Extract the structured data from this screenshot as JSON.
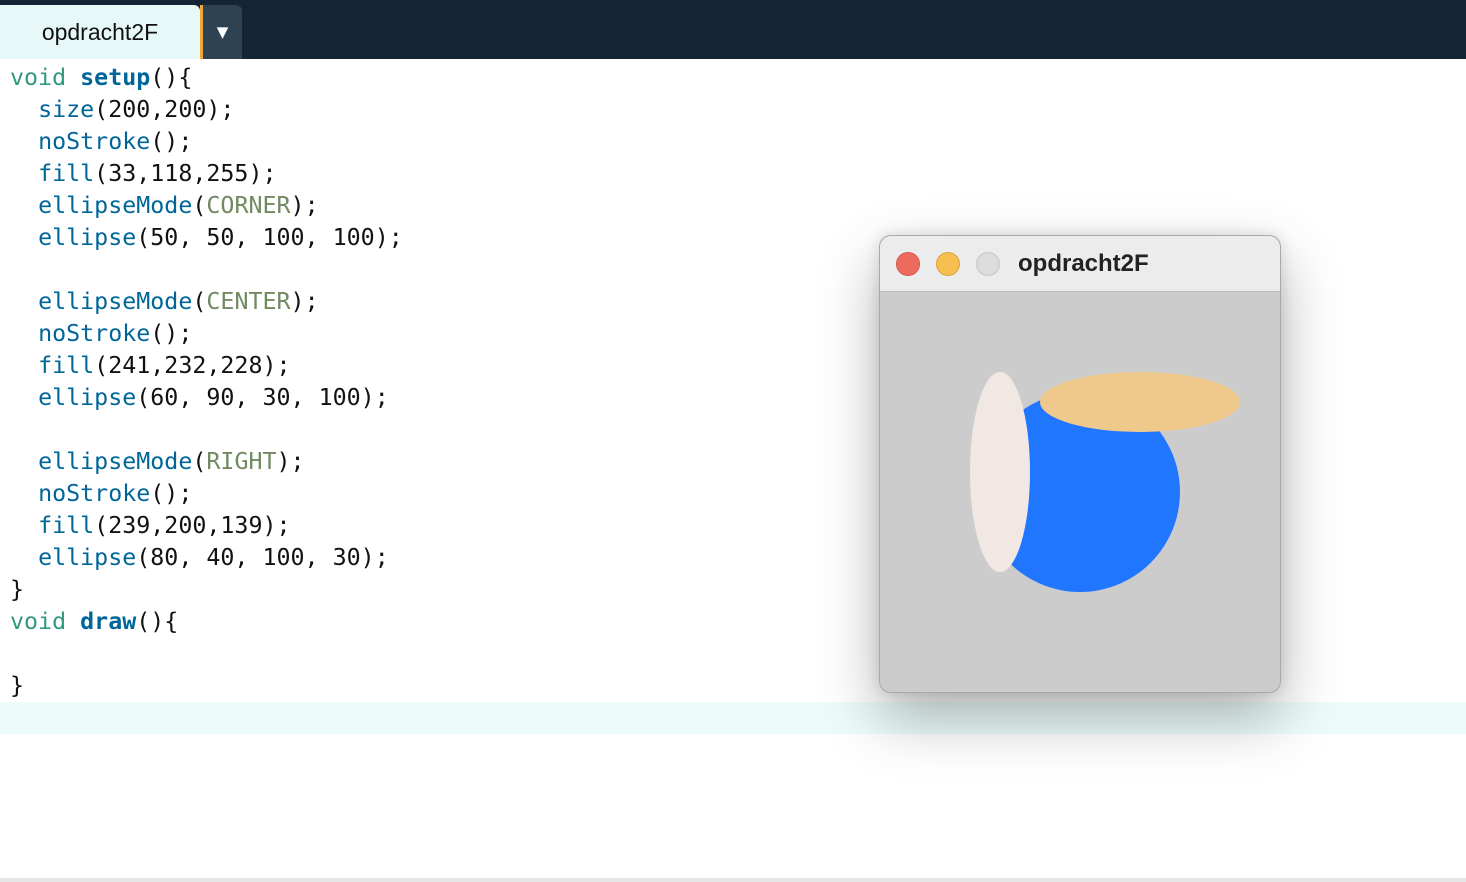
{
  "tab": {
    "label": "opdracht2F",
    "menu_icon": "▼"
  },
  "code": {
    "lines": [
      [
        {
          "t": "void",
          "c": "kw"
        },
        {
          "t": " "
        },
        {
          "t": "setup",
          "c": "fn"
        },
        {
          "t": "(){"
        }
      ],
      [
        {
          "t": "  "
        },
        {
          "t": "size",
          "c": "call"
        },
        {
          "t": "(200,200);"
        }
      ],
      [
        {
          "t": "  "
        },
        {
          "t": "noStroke",
          "c": "call"
        },
        {
          "t": "();"
        }
      ],
      [
        {
          "t": "  "
        },
        {
          "t": "fill",
          "c": "call"
        },
        {
          "t": "(33,118,255);"
        }
      ],
      [
        {
          "t": "  "
        },
        {
          "t": "ellipseMode",
          "c": "call"
        },
        {
          "t": "("
        },
        {
          "t": "CORNER",
          "c": "cst"
        },
        {
          "t": ");"
        }
      ],
      [
        {
          "t": "  "
        },
        {
          "t": "ellipse",
          "c": "call"
        },
        {
          "t": "(50, 50, 100, 100);"
        }
      ],
      [],
      [
        {
          "t": "  "
        },
        {
          "t": "ellipseMode",
          "c": "call"
        },
        {
          "t": "("
        },
        {
          "t": "CENTER",
          "c": "cst"
        },
        {
          "t": ");"
        }
      ],
      [
        {
          "t": "  "
        },
        {
          "t": "noStroke",
          "c": "call"
        },
        {
          "t": "();"
        }
      ],
      [
        {
          "t": "  "
        },
        {
          "t": "fill",
          "c": "call"
        },
        {
          "t": "(241,232,228);"
        }
      ],
      [
        {
          "t": "  "
        },
        {
          "t": "ellipse",
          "c": "call"
        },
        {
          "t": "(60, 90, 30, 100);"
        }
      ],
      [],
      [
        {
          "t": "  "
        },
        {
          "t": "ellipseMode",
          "c": "call"
        },
        {
          "t": "("
        },
        {
          "t": "RIGHT",
          "c": "cst"
        },
        {
          "t": ");"
        }
      ],
      [
        {
          "t": "  "
        },
        {
          "t": "noStroke",
          "c": "call"
        },
        {
          "t": "();"
        }
      ],
      [
        {
          "t": "  "
        },
        {
          "t": "fill",
          "c": "call"
        },
        {
          "t": "(239,200,139);"
        }
      ],
      [
        {
          "t": "  "
        },
        {
          "t": "ellipse",
          "c": "call"
        },
        {
          "t": "(80, 40, 100, 30);"
        }
      ],
      [
        {
          "t": "}"
        }
      ],
      [
        {
          "t": "void",
          "c": "kw"
        },
        {
          "t": " "
        },
        {
          "t": "draw",
          "c": "fn"
        },
        {
          "t": "(){"
        }
      ],
      [],
      [
        {
          "t": "}"
        }
      ]
    ]
  },
  "sketch_window": {
    "title": "opdracht2F",
    "background": "#cccccc",
    "shapes": [
      {
        "name": "blue-circle",
        "fill": "#2176ff"
      },
      {
        "name": "light-ellipse",
        "fill": "#f1e8e4"
      },
      {
        "name": "tan-ellipse",
        "fill": "#efc88b"
      }
    ]
  }
}
